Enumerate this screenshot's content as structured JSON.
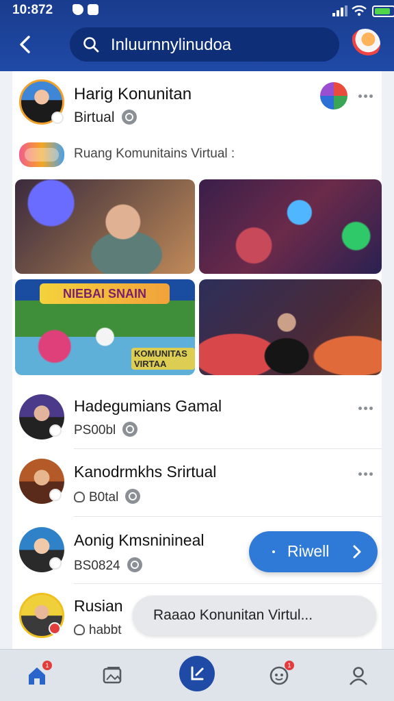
{
  "status_bar": {
    "time": "10:872"
  },
  "search": {
    "text": "Inluurnnylinudoa"
  },
  "post": {
    "title": "Harig Konunitan",
    "subtitle": "Birtual",
    "tag_text": "Ruang Komunitains  Virtual :",
    "tile_banner": "NIEBAI SNAIN",
    "tile_caption": "KOMUNITAS VIRTAA"
  },
  "rows": [
    {
      "name": "Hadegumians Gamal",
      "meta": "PS00bl"
    },
    {
      "name": "Kanodrmkhs Srirtual",
      "meta": "B0tal"
    },
    {
      "name": "Aonig Kmsninineal",
      "meta": "BS0824"
    },
    {
      "name": "Rusian",
      "meta": "habbt"
    }
  ],
  "action_button": {
    "label": "Riwell"
  },
  "toast": {
    "text": "Raaao Konunitan Virtul..."
  },
  "nav": {
    "home_badge": "1",
    "chat_badge": "1"
  }
}
